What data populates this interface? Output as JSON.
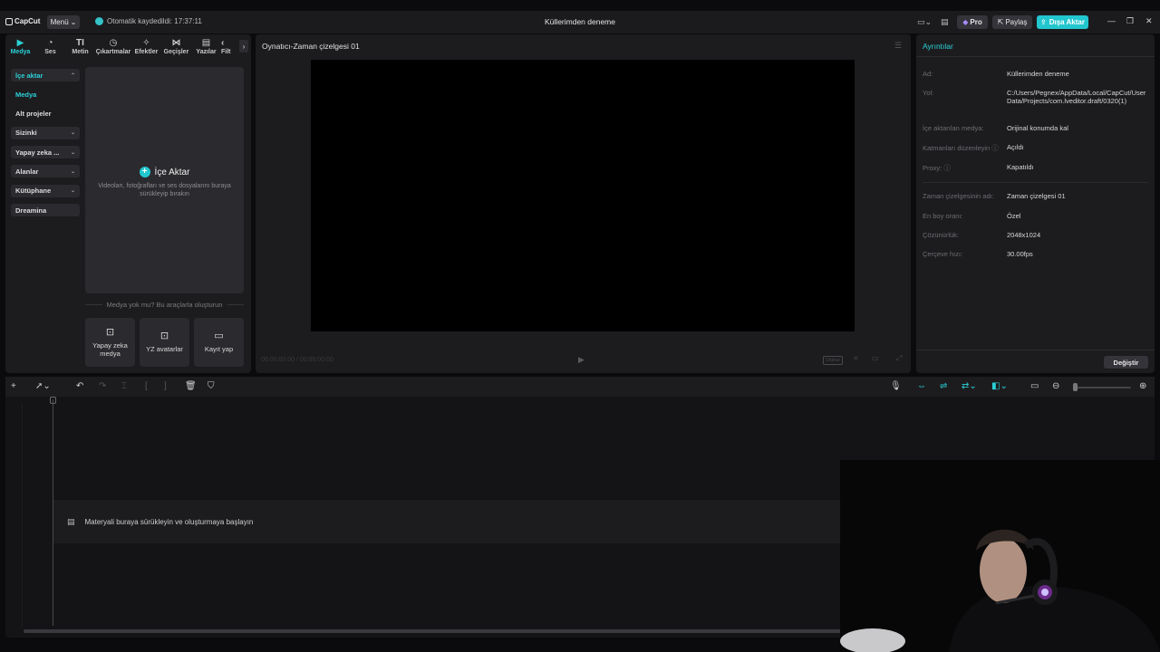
{
  "app": {
    "logo": "CapCut",
    "menu_label": "Menü",
    "autosave": "Otomatik kaydedildi: 17:37:11",
    "project_title": "Küllerimden deneme",
    "pro_label": "Pro",
    "share_label": "Paylaş",
    "export_label": "Dışa Aktar"
  },
  "tool_tabs": [
    {
      "label": "Medya",
      "icon": "media-icon"
    },
    {
      "label": "Ses",
      "icon": "audio-icon"
    },
    {
      "label": "Metin",
      "icon": "text-icon"
    },
    {
      "label": "Çıkartmalar",
      "icon": "sticker-icon"
    },
    {
      "label": "Efektler",
      "icon": "effects-icon"
    },
    {
      "label": "Geçişler",
      "icon": "transitions-icon"
    },
    {
      "label": "Yazılar",
      "icon": "captions-icon"
    },
    {
      "label": "Filt",
      "icon": "filters-icon"
    }
  ],
  "side_nav": {
    "import": "İçe aktar",
    "media": "Medya",
    "subprojects": "Alt projeler",
    "yours": "Sizinki",
    "ai": "Yapay zeka ...",
    "spaces": "Alanlar",
    "library": "Kütüphane",
    "dreamina": "Dreamina"
  },
  "import_box": {
    "title": "İçe Aktar",
    "hint": "Videoları, fotoğrafları ve ses dosyalarını buraya sürükleyip bırakın"
  },
  "create": {
    "hint": "Medya yok mu? Bu araçlarla oluşturun",
    "tiles": [
      "Yapay zeka medya",
      "YZ avatarlar",
      "Kayıt yap"
    ]
  },
  "player": {
    "title": "Oynatıcı-Zaman çizelgesi 01",
    "timecode": "00:00:00:00 / 00:00:00:00",
    "ratio_label": "Orijinal"
  },
  "details": {
    "title": "Ayrıntılar",
    "rows": [
      {
        "k": "Ad:",
        "v": "Küllerimden deneme"
      },
      {
        "k": "Yol:",
        "v": "C:/Users/Pegnex/AppData/Local/CapCut/User Data/Projects/com.lveditor.draft/0320(1)"
      },
      {
        "k": "İçe aktarılan medya:",
        "v": "Orijinal konumda kal"
      },
      {
        "k": "Katmanları düzenleyin ⓘ",
        "v": "Açıldı"
      },
      {
        "k": "Proxy: ⓘ",
        "v": "Kapatıldı"
      },
      {
        "k": "Zaman çizelgesinin adı:",
        "v": "Zaman çizelgesi 01"
      },
      {
        "k": "En boy oranı:",
        "v": "Özel"
      },
      {
        "k": "Çözünürlük:",
        "v": "2048x1024"
      },
      {
        "k": "Çerçeve hızı:",
        "v": "30.00fps"
      }
    ],
    "change_label": "Değiştir"
  },
  "timeline": {
    "drop_text": "Materyali buraya sürükleyin ve oluşturmaya başlayın"
  },
  "colors": {
    "accent": "#22c6cf",
    "bg": "#0b0b0d",
    "panel": "#1c1c1f"
  }
}
